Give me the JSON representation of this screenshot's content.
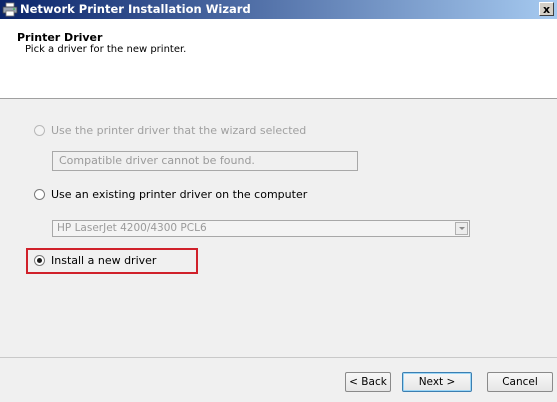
{
  "window": {
    "title": "Network Printer Installation Wizard",
    "close_glyph": "x"
  },
  "header": {
    "heading": "Printer Driver",
    "subheading": "Pick a driver for the new printer."
  },
  "options": [
    {
      "label": "Use the printer driver that the wizard selected",
      "selected": false,
      "enabled": false,
      "field_value": "Compatible driver cannot be found."
    },
    {
      "label": "Use an existing printer driver on the computer",
      "selected": false,
      "enabled": true,
      "field_value": "HP LaserJet 4200/4300 PCL6"
    },
    {
      "label": "Install a new driver",
      "selected": true,
      "enabled": true
    }
  ],
  "buttons": {
    "back": "< Back",
    "next": "Next >",
    "cancel": "Cancel"
  },
  "colors": {
    "highlight_box": "#d0202a",
    "title_bar_start": "#0a246a",
    "title_bar_end": "#a6caf0"
  },
  "icons": {
    "app_icon": "printer-icon",
    "dropdown_arrow": "chevron-down-icon"
  }
}
